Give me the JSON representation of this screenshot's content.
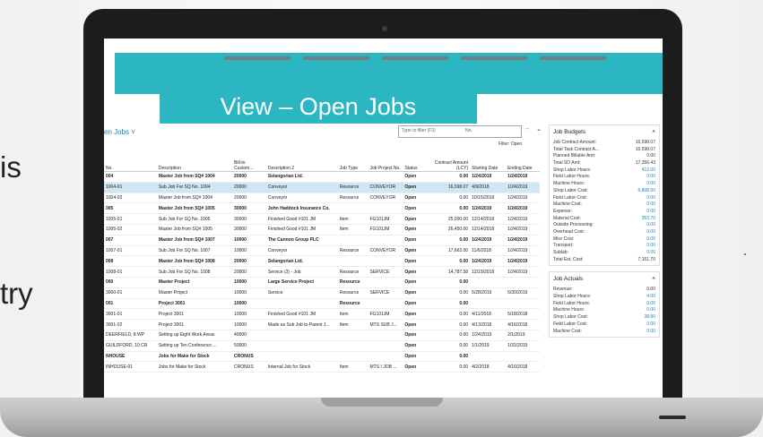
{
  "slide": {
    "fragments": [
      "is",
      "try"
    ]
  },
  "banner_title": "View – Open Jobs",
  "page": {
    "title": "en Jobs",
    "dropdown_glyph": "˅"
  },
  "filter": {
    "placeholder": "Type to filter (F3)",
    "field": "No.",
    "label": "Filter: Open"
  },
  "nav": {
    "arrow": "→",
    "collapse": "⌄"
  },
  "columns": [
    "No.",
    "Description",
    "Bill-to Custom...",
    "Description 2",
    "Job Type",
    "Job Project No.",
    "Status",
    "Contract Amount (LCY)",
    "Starting Date",
    "Ending Date"
  ],
  "rows": [
    {
      "no": "004",
      "desc": "Master Job from SQ# 1004",
      "bill": "20000",
      "desc2": "Selangorian Ltd.",
      "type": "",
      "proj": "",
      "status": "Open",
      "amt": "0.00",
      "start": "1/24/2019",
      "end": "1/24/2019",
      "bold": true
    },
    {
      "no": "1004-01",
      "desc": "Sub Job For SQ No. 1004",
      "bill": "20000",
      "desc2": "Conveyor",
      "type": "Resource",
      "proj": "CONVEYOR",
      "status": "Open",
      "amt": "16,598.07",
      "start": "4/9/2018",
      "end": "1/24/2019",
      "sel": true
    },
    {
      "no": "1004-02",
      "desc": "Master Job from SQ# 1004",
      "bill": "20000",
      "desc2": "Conveyor",
      "type": "Resource",
      "proj": "CONVEYOR",
      "status": "Open",
      "amt": "0.00",
      "start": "10/15/2018",
      "end": "1/24/2019"
    },
    {
      "no": "005",
      "desc": "Master Job from SQ# 1005",
      "bill": "30000",
      "desc2": "John Haddock Insurance Co.",
      "type": "",
      "proj": "",
      "status": "Open",
      "amt": "0.00",
      "start": "1/24/2019",
      "end": "1/24/2019",
      "bold": true
    },
    {
      "no": "1005-01",
      "desc": "Sub Job For SQ No. 1005",
      "bill": "30000",
      "desc2": "Finished Good #101 JM",
      "type": "Item",
      "proj": "FG101JM",
      "status": "Open",
      "amt": "25,000.00",
      "start": "12/14/2018",
      "end": "1/24/2019"
    },
    {
      "no": "1005-02",
      "desc": "Master Job from SQ# 1005",
      "bill": "30000",
      "desc2": "Finished Good #101 JM",
      "type": "Item",
      "proj": "FG101JM",
      "status": "Open",
      "amt": "26,450.00",
      "start": "12/14/2018",
      "end": "1/24/2019"
    },
    {
      "no": "007",
      "desc": "Master Job from SQ# 1007",
      "bill": "10000",
      "desc2": "The Cannon Group PLC",
      "type": "",
      "proj": "",
      "status": "Open",
      "amt": "0.00",
      "start": "1/24/2019",
      "end": "1/24/2019",
      "bold": true
    },
    {
      "no": "1007-01",
      "desc": "Sub Job For SQ No. 1007",
      "bill": "10000",
      "desc2": "Conveyor",
      "type": "Resource",
      "proj": "CONVEYOR",
      "status": "Open",
      "amt": "17,662.00",
      "start": "11/6/2018",
      "end": "1/24/2019"
    },
    {
      "no": "008",
      "desc": "Master Job from SQ# 1008",
      "bill": "20000",
      "desc2": "Selangorian Ltd.",
      "type": "",
      "proj": "",
      "status": "Open",
      "amt": "0.00",
      "start": "1/24/2019",
      "end": "1/24/2019",
      "bold": true
    },
    {
      "no": "1008-01",
      "desc": "Sub Job For SQ No. 1008",
      "bill": "20000",
      "desc2": "Service (3) - Job",
      "type": "Resource",
      "proj": "SERVICE",
      "status": "Open",
      "amt": "14,787.58",
      "start": "12/19/2018",
      "end": "1/24/2019"
    },
    {
      "no": "000",
      "desc": "Master Project",
      "bill": "10000",
      "desc2": "Large Service Project",
      "type": "Resource",
      "proj": "",
      "status": "Open",
      "amt": "0.00",
      "start": "",
      "end": "",
      "bold": true
    },
    {
      "no": "3000-01",
      "desc": "Master Project",
      "bill": "10000",
      "desc2": "Service",
      "type": "Resource",
      "proj": "SERVICE",
      "status": "Open",
      "amt": "0.00",
      "start": "5/28/2019",
      "end": "6/30/2019"
    },
    {
      "no": "001",
      "desc": "Project 3001",
      "bill": "10000",
      "desc2": "",
      "type": "Resource",
      "proj": "",
      "status": "Open",
      "amt": "0.00",
      "start": "",
      "end": "",
      "bold": true
    },
    {
      "no": "3001-01",
      "desc": "Project 3001",
      "bill": "10000",
      "desc2": "Finished Good #101 JM",
      "type": "Item",
      "proj": "FG101JM",
      "status": "Open",
      "amt": "0.00",
      "start": "4/11/2018",
      "end": "5/18/2018"
    },
    {
      "no": "3001-02",
      "desc": "Project 3001",
      "bill": "10000",
      "desc2": "Made as Sub Job to Parent J...",
      "type": "Item",
      "proj": "MTS SUB J...",
      "status": "Open",
      "amt": "0.00",
      "start": "4/13/2018",
      "end": "4/16/2018"
    },
    {
      "no": "DEERFIELD, 8 WP",
      "desc": "Setting up Eight Work Areas",
      "bill": "40000",
      "desc2": "",
      "type": "",
      "proj": "",
      "status": "Open",
      "amt": "0.00",
      "start": "1/24/2019",
      "end": "2/1/2019"
    },
    {
      "no": "GUILDFORD, 10 CR",
      "desc": "Setting up Ten Conference ...",
      "bill": "50000",
      "desc2": "",
      "type": "",
      "proj": "",
      "status": "Open",
      "amt": "0.00",
      "start": "1/1/2019",
      "end": "1/31/2019"
    },
    {
      "no": "NHOUSE",
      "desc": "Jobs for Make for Stock",
      "bill": "CRONUS",
      "desc2": "",
      "type": "",
      "proj": "",
      "status": "Open",
      "amt": "0.00",
      "start": "",
      "end": "",
      "bold": true
    },
    {
      "no": "INHOUSE-01",
      "desc": "Jobs for Make for Stock",
      "bill": "CRONUS",
      "desc2": "Internal Job for Stock",
      "type": "Item",
      "proj": "MTS I JOB ...",
      "status": "Open",
      "amt": "0.00",
      "start": "4/2/2018",
      "end": "4/16/2018"
    }
  ],
  "budgets": {
    "title": "Job Budgets",
    "rows": [
      {
        "l": "Job Contract Amount:",
        "v": "16,598.07"
      },
      {
        "l": "Total Task Contract A...",
        "v": "16,598.07"
      },
      {
        "l": "Planned Billable Amt:",
        "v": "0.00"
      },
      {
        "l": "Total SO Amt:",
        "v": "17,356.43"
      },
      {
        "l": "Shop Labor Hours:",
        "v": "412.00",
        "link": true
      },
      {
        "l": "Field Labor Hours:",
        "v": "0.00",
        "link": true
      },
      {
        "l": "Machine Hours:",
        "v": "0.00",
        "link": true
      },
      {
        "l": "Shop Labor Cost:",
        "v": "6,808.00",
        "link": true
      },
      {
        "l": "Field Labor Cost:",
        "v": "0.00",
        "link": true
      },
      {
        "l": "Machine Cost:",
        "v": "0.00",
        "link": true
      },
      {
        "l": "Expense:",
        "v": "0.00",
        "link": true
      },
      {
        "l": "Material Cost:",
        "v": "353.70",
        "link": true
      },
      {
        "l": "Outside Processing:",
        "v": "0.00",
        "link": true
      },
      {
        "l": "Overhead Cost:",
        "v": "0.00",
        "link": true
      },
      {
        "l": "Misc Cost:",
        "v": "0.00",
        "link": true
      },
      {
        "l": "Transport:",
        "v": "0.00",
        "link": true
      },
      {
        "l": "Sublab:",
        "v": "0.00",
        "link": true
      },
      {
        "l": "Total Est. Cost:",
        "v": "7,161.70"
      }
    ]
  },
  "actuals": {
    "title": "Job Actuals",
    "rows": [
      {
        "l": "Revenue:",
        "v": "0.00"
      },
      {
        "l": "Shop Labor Hours:",
        "v": "4.00",
        "link": true
      },
      {
        "l": "Field Labor Hours:",
        "v": "0.00",
        "link": true
      },
      {
        "l": "Machine Hours:",
        "v": "0.00",
        "link": true
      },
      {
        "l": "Shop Labor Cost:",
        "v": "38.80",
        "link": true
      },
      {
        "l": "Field Labor Cost:",
        "v": "0.00",
        "link": true
      },
      {
        "l": "Machine Cost:",
        "v": "0.00",
        "link": true
      }
    ]
  }
}
